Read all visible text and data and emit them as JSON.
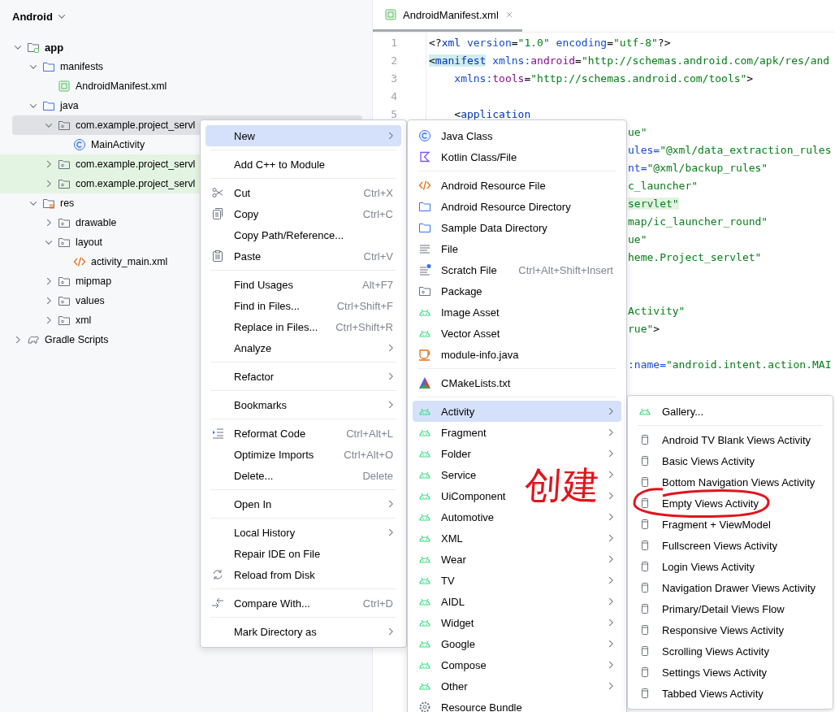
{
  "project_view": {
    "title": "Android",
    "nodes": [
      {
        "label": "app",
        "kind": "module",
        "expanded": true,
        "selected": false,
        "highlighted": false,
        "children": [
          {
            "label": "manifests",
            "kind": "folder",
            "expanded": true,
            "selected": false,
            "highlighted": false,
            "children": [
              {
                "label": "AndroidManifest.xml",
                "kind": "manifest",
                "selected": false,
                "highlighted": false
              }
            ]
          },
          {
            "label": "java",
            "kind": "folder",
            "expanded": true,
            "selected": false,
            "highlighted": false,
            "children": [
              {
                "label": "com.example.project_servl",
                "kind": "package",
                "expanded": true,
                "selected": true,
                "highlighted": false,
                "children": [
                  {
                    "label": "MainActivity",
                    "kind": "class",
                    "selected": false,
                    "highlighted": false
                  }
                ]
              },
              {
                "label": "com.example.project_servl",
                "kind": "package",
                "expanded": false,
                "selected": false,
                "highlighted": true
              },
              {
                "label": "com.example.project_servl",
                "kind": "package",
                "expanded": false,
                "selected": false,
                "highlighted": true
              }
            ]
          },
          {
            "label": "res",
            "kind": "resources",
            "expanded": true,
            "selected": false,
            "highlighted": false,
            "children": [
              {
                "label": "drawable",
                "kind": "package",
                "expanded": false,
                "selected": false,
                "highlighted": false
              },
              {
                "label": "layout",
                "kind": "package",
                "expanded": true,
                "selected": false,
                "highlighted": false,
                "children": [
                  {
                    "label": "activity_main.xml",
                    "kind": "layout",
                    "selected": false,
                    "highlighted": false
                  }
                ]
              },
              {
                "label": "mipmap",
                "kind": "package",
                "expanded": false,
                "selected": false,
                "highlighted": false
              },
              {
                "label": "values",
                "kind": "package",
                "expanded": false,
                "selected": false,
                "highlighted": false
              },
              {
                "label": "xml",
                "kind": "package",
                "expanded": false,
                "selected": false,
                "highlighted": false
              }
            ]
          }
        ]
      },
      {
        "label": "Gradle Scripts",
        "kind": "gradle",
        "expanded": false,
        "selected": false,
        "highlighted": false
      }
    ]
  },
  "editor": {
    "tabs": [
      {
        "label": "AndroidManifest.xml",
        "selected": true
      }
    ],
    "lines": [
      {
        "kind": "numbered",
        "number": "1",
        "tokens": [
          {
            "kind": "punct",
            "text": "<?",
            "marked": false
          },
          {
            "kind": "tag",
            "text": "xml",
            "marked": false
          },
          {
            "kind": "attr",
            "text": " version",
            "marked": false
          },
          {
            "kind": "punct",
            "text": "=",
            "marked": false
          },
          {
            "kind": "value",
            "text": "\"1.0\"",
            "marked": false
          },
          {
            "kind": "attr",
            "text": " encoding",
            "marked": false
          },
          {
            "kind": "punct",
            "text": "=",
            "marked": false
          },
          {
            "kind": "value",
            "text": "\"utf-8\"",
            "marked": false
          },
          {
            "kind": "punct",
            "text": "?>",
            "marked": false
          }
        ]
      },
      {
        "kind": "numbered",
        "number": "2",
        "tokens": [
          {
            "kind": "punct",
            "text": "<",
            "marked": true
          },
          {
            "kind": "tag",
            "text": "manifest",
            "marked": true
          },
          {
            "kind": "attr",
            "text": " xmlns:",
            "marked": false
          },
          {
            "kind": "ns",
            "text": "android",
            "marked": false
          },
          {
            "kind": "punct",
            "text": "=",
            "marked": false
          },
          {
            "kind": "value",
            "text": "\"http://schemas.android.com/apk/res/and",
            "marked": false
          }
        ]
      },
      {
        "kind": "numbered",
        "number": "3",
        "tokens": [
          {
            "kind": "attr",
            "text": "    xmlns:",
            "marked": false
          },
          {
            "kind": "ns",
            "text": "tools",
            "marked": false
          },
          {
            "kind": "punct",
            "text": "=",
            "marked": false
          },
          {
            "kind": "value",
            "text": "\"http://schemas.android.com/tools\"",
            "marked": false
          },
          {
            "kind": "punct",
            "text": ">",
            "marked": false
          }
        ]
      },
      {
        "kind": "numbered",
        "number": "4"
      },
      {
        "kind": "numbered",
        "number": "5",
        "tokens": [
          {
            "kind": "punct",
            "text": "    <",
            "marked": false
          },
          {
            "kind": "tag",
            "text": "application",
            "marked": false
          }
        ]
      },
      {
        "kind": "fragment",
        "tokens": [
          {
            "kind": "value",
            "text": "ue\"",
            "marked": false
          }
        ]
      },
      {
        "kind": "fragment",
        "tokens": [
          {
            "kind": "attr",
            "text": "ules=",
            "marked": false
          },
          {
            "kind": "value",
            "text": "\"@xml/data_extraction_rules",
            "marked": false
          }
        ]
      },
      {
        "kind": "fragment",
        "tokens": [
          {
            "kind": "attr",
            "text": "nt=",
            "marked": false
          },
          {
            "kind": "value",
            "text": "\"@xml/backup_rules\"",
            "marked": false
          }
        ]
      },
      {
        "kind": "fragment",
        "tokens": [
          {
            "kind": "value",
            "text": "c_launcher\"",
            "marked": false
          }
        ]
      },
      {
        "kind": "fragment",
        "tokens": [
          {
            "kind": "value",
            "text": "servlet\"",
            "marked": true
          }
        ]
      },
      {
        "kind": "fragment",
        "tokens": [
          {
            "kind": "value",
            "text": "map/ic_launcher_round\"",
            "marked": false
          }
        ]
      },
      {
        "kind": "fragment",
        "tokens": [
          {
            "kind": "value",
            "text": "ue\"",
            "marked": false
          }
        ]
      },
      {
        "kind": "fragment",
        "tokens": [
          {
            "kind": "value",
            "text": "heme.Project_servlet\"",
            "marked": false
          }
        ]
      },
      {
        "kind": "blank"
      },
      {
        "kind": "blank"
      },
      {
        "kind": "fragment",
        "tokens": [
          {
            "kind": "value",
            "text": "Activity\"",
            "marked": false
          }
        ]
      },
      {
        "kind": "fragment",
        "tokens": [
          {
            "kind": "value",
            "text": "rue\"",
            "marked": false
          },
          {
            "kind": "punct",
            "text": ">",
            "marked": false
          }
        ]
      },
      {
        "kind": "blank"
      },
      {
        "kind": "fragment",
        "tokens": [
          {
            "kind": "attr",
            "text": ":name=",
            "marked": false
          },
          {
            "kind": "value",
            "text": "\"android.intent.action.MAI",
            "marked": false
          }
        ]
      }
    ]
  },
  "menus": [
    {
      "groups": [
        [
          {
            "label": "New",
            "kind": "plain",
            "submenu": true,
            "selected": true
          }
        ],
        [
          {
            "label": "Add C++ to Module",
            "kind": "plain",
            "submenu": false,
            "selected": false
          }
        ],
        [
          {
            "label": "Cut",
            "kind": "cut",
            "shortcut": "Ctrl+X",
            "submenu": false,
            "selected": false
          },
          {
            "label": "Copy",
            "kind": "copy",
            "shortcut": "Ctrl+C",
            "submenu": false,
            "selected": false
          },
          {
            "label": "Copy Path/Reference...",
            "kind": "plain",
            "submenu": false,
            "selected": false
          },
          {
            "label": "Paste",
            "kind": "paste",
            "shortcut": "Ctrl+V",
            "submenu": false,
            "selected": false
          }
        ],
        [
          {
            "label": "Find Usages",
            "kind": "plain",
            "shortcut": "Alt+F7",
            "submenu": false,
            "selected": false
          },
          {
            "label": "Find in Files...",
            "kind": "plain",
            "shortcut": "Ctrl+Shift+F",
            "submenu": false,
            "selected": false
          },
          {
            "label": "Replace in Files...",
            "kind": "plain",
            "shortcut": "Ctrl+Shift+R",
            "submenu": false,
            "selected": false
          },
          {
            "label": "Analyze",
            "kind": "plain",
            "submenu": true,
            "selected": false
          }
        ],
        [
          {
            "label": "Refactor",
            "kind": "plain",
            "submenu": true,
            "selected": false
          }
        ],
        [
          {
            "label": "Bookmarks",
            "kind": "plain",
            "submenu": true,
            "selected": false
          }
        ],
        [
          {
            "label": "Reformat Code",
            "kind": "reformat",
            "shortcut": "Ctrl+Alt+L",
            "submenu": false,
            "selected": false
          },
          {
            "label": "Optimize Imports",
            "kind": "plain",
            "shortcut": "Ctrl+Alt+O",
            "submenu": false,
            "selected": false
          },
          {
            "label": "Delete...",
            "kind": "plain",
            "shortcut": "Delete",
            "submenu": false,
            "selected": false
          }
        ],
        [
          {
            "label": "Open In",
            "kind": "plain",
            "submenu": true,
            "selected": false
          }
        ],
        [
          {
            "label": "Local History",
            "kind": "plain",
            "submenu": true,
            "selected": false
          },
          {
            "label": "Repair IDE on File",
            "kind": "plain",
            "submenu": false,
            "selected": false
          },
          {
            "label": "Reload from Disk",
            "kind": "reload",
            "submenu": false,
            "selected": false
          }
        ],
        [
          {
            "label": "Compare With...",
            "kind": "compare",
            "shortcut": "Ctrl+D",
            "submenu": false,
            "selected": false
          }
        ],
        [
          {
            "label": "Mark Directory as",
            "kind": "plain",
            "submenu": true,
            "selected": false
          }
        ]
      ]
    },
    {
      "groups": [
        [
          {
            "label": "Java Class",
            "kind": "javaclass",
            "submenu": false,
            "selected": false
          },
          {
            "label": "Kotlin Class/File",
            "kind": "kotlin",
            "submenu": false,
            "selected": false
          }
        ],
        [
          {
            "label": "Android Resource File",
            "kind": "resfile",
            "submenu": false,
            "selected": false
          },
          {
            "label": "Android Resource Directory",
            "kind": "folder",
            "submenu": false,
            "selected": false
          },
          {
            "label": "Sample Data Directory",
            "kind": "folder",
            "submenu": false,
            "selected": false
          },
          {
            "label": "File",
            "kind": "file",
            "submenu": false,
            "selected": false
          },
          {
            "label": "Scratch File",
            "kind": "scratch",
            "shortcut": "Ctrl+Alt+Shift+Insert",
            "submenu": false,
            "selected": false
          },
          {
            "label": "Package",
            "kind": "package",
            "submenu": false,
            "selected": false
          },
          {
            "label": "Image Asset",
            "kind": "android",
            "submenu": false,
            "selected": false
          },
          {
            "label": "Vector Asset",
            "kind": "android",
            "submenu": false,
            "selected": false
          },
          {
            "label": "module-info.java",
            "kind": "cup",
            "submenu": false,
            "selected": false
          }
        ],
        [
          {
            "label": "CMakeLists.txt",
            "kind": "cmake",
            "submenu": false,
            "selected": false
          }
        ],
        [
          {
            "label": "Activity",
            "kind": "android",
            "submenu": true,
            "selected": true
          },
          {
            "label": "Fragment",
            "kind": "android",
            "submenu": true,
            "selected": false
          },
          {
            "label": "Folder",
            "kind": "android",
            "submenu": true,
            "selected": false
          },
          {
            "label": "Service",
            "kind": "android",
            "submenu": true,
            "selected": false
          },
          {
            "label": "UiComponent",
            "kind": "android",
            "submenu": true,
            "selected": false
          },
          {
            "label": "Automotive",
            "kind": "android",
            "submenu": true,
            "selected": false
          },
          {
            "label": "XML",
            "kind": "android",
            "submenu": true,
            "selected": false
          },
          {
            "label": "Wear",
            "kind": "android",
            "submenu": true,
            "selected": false
          },
          {
            "label": "TV",
            "kind": "android",
            "submenu": true,
            "selected": false
          },
          {
            "label": "AIDL",
            "kind": "android",
            "submenu": true,
            "selected": false
          },
          {
            "label": "Widget",
            "kind": "android",
            "submenu": true,
            "selected": false
          },
          {
            "label": "Google",
            "kind": "android",
            "submenu": true,
            "selected": false
          },
          {
            "label": "Compose",
            "kind": "android",
            "submenu": true,
            "selected": false
          },
          {
            "label": "Other",
            "kind": "android",
            "submenu": true,
            "selected": false
          },
          {
            "label": "Resource Bundle",
            "kind": "gear",
            "submenu": false,
            "selected": false
          }
        ]
      ]
    },
    {
      "groups": [
        [
          {
            "label": "Gallery...",
            "kind": "android",
            "submenu": false,
            "selected": false
          }
        ],
        [
          {
            "label": "Android TV Blank Views Activity",
            "kind": "template",
            "submenu": false,
            "selected": false
          },
          {
            "label": "Basic Views Activity",
            "kind": "template",
            "submenu": false,
            "selected": false
          },
          {
            "label": "Bottom Navigation Views Activity",
            "kind": "template",
            "submenu": false,
            "selected": false
          },
          {
            "label": "Empty Views Activity",
            "kind": "template",
            "submenu": false,
            "selected": false
          },
          {
            "label": "Fragment + ViewModel",
            "kind": "template",
            "submenu": false,
            "selected": false
          },
          {
            "label": "Fullscreen Views Activity",
            "kind": "template",
            "submenu": false,
            "selected": false
          },
          {
            "label": "Login Views Activity",
            "kind": "template",
            "submenu": false,
            "selected": false
          },
          {
            "label": "Navigation Drawer Views Activity",
            "kind": "template",
            "submenu": false,
            "selected": false
          },
          {
            "label": "Primary/Detail Views Flow",
            "kind": "template",
            "submenu": false,
            "selected": false
          },
          {
            "label": "Responsive Views Activity",
            "kind": "template",
            "submenu": false,
            "selected": false
          },
          {
            "label": "Scrolling Views Activity",
            "kind": "template",
            "submenu": false,
            "selected": false
          },
          {
            "label": "Settings Views Activity",
            "kind": "template",
            "submenu": false,
            "selected": false
          },
          {
            "label": "Tabbed Views Activity",
            "kind": "template",
            "submenu": false,
            "selected": false
          }
        ]
      ]
    }
  ],
  "annotation": {
    "text": "创建"
  }
}
